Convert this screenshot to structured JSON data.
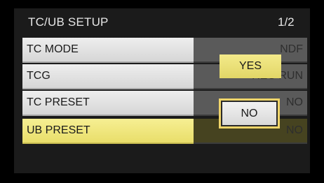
{
  "header": {
    "title": "TC/UB SETUP",
    "page_indicator": "1/2"
  },
  "menu": {
    "items": [
      {
        "label": "TC MODE",
        "value": "NDF",
        "selected": false
      },
      {
        "label": "TCG",
        "value": "REC RUN",
        "selected": false
      },
      {
        "label": "TC PRESET",
        "value": "NO",
        "selected": false
      },
      {
        "label": "UB PRESET",
        "value": "NO",
        "selected": true
      }
    ]
  },
  "dialog": {
    "yes_label": "YES",
    "no_label": "NO",
    "focused": "NO"
  },
  "colors": {
    "background": "#000000",
    "row_label_bg": "#e3e3e3",
    "row_value_bg": "#5a5a5a",
    "selected_bg": "#f0e780",
    "focus_border": "#f0d56a"
  }
}
